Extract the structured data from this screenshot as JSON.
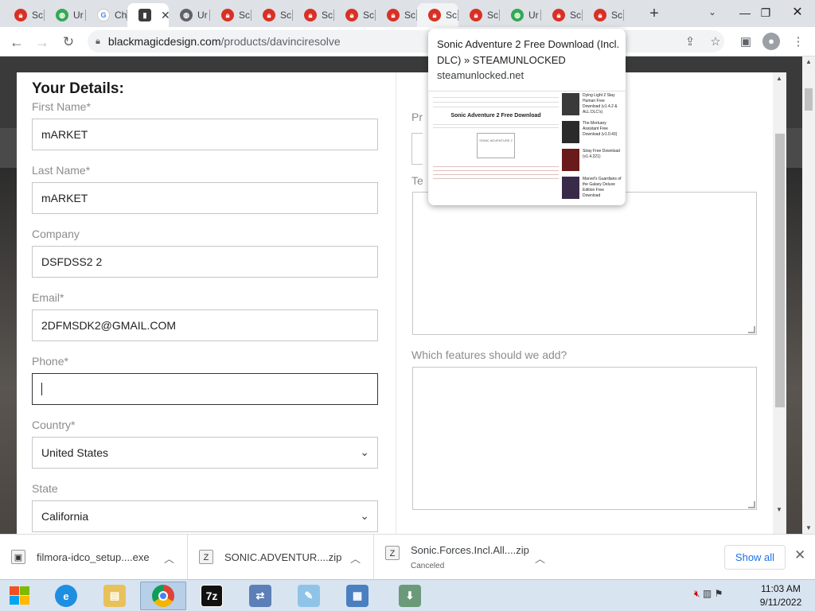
{
  "browser": {
    "tabs": [
      {
        "label": "Sc",
        "favicon": "red-lock-icon"
      },
      {
        "label": "Ur",
        "favicon": "green-globe-icon"
      },
      {
        "label": "Ch",
        "favicon": "google-icon"
      },
      {
        "label": "",
        "favicon": "dark-site-icon",
        "active": true
      },
      {
        "label": "Ur",
        "favicon": "globe-icon"
      },
      {
        "label": "Sc",
        "favicon": "red-lock-icon"
      },
      {
        "label": "Sc",
        "favicon": "red-lock-icon"
      },
      {
        "label": "Sc",
        "favicon": "red-lock-icon"
      },
      {
        "label": "Sc",
        "favicon": "red-lock-icon"
      },
      {
        "label": "Sc",
        "favicon": "red-lock-icon"
      },
      {
        "label": "Sc",
        "favicon": "red-lock-icon",
        "hovered": true
      },
      {
        "label": "Sc",
        "favicon": "red-lock-icon"
      },
      {
        "label": "Ur",
        "favicon": "green-globe-icon"
      },
      {
        "label": "Sc",
        "favicon": "red-lock-icon"
      },
      {
        "label": "Sc",
        "favicon": "red-lock-icon"
      }
    ],
    "url": {
      "host": "blackmagicdesign.com",
      "path": "/products/davinciresolve"
    },
    "hover_card": {
      "title": "Sonic Adventure 2 Free Download (Incl. DLC) » STEAMUNLOCKED",
      "domain": "steamunlocked.net",
      "thumb_heading": "Sonic Adventure 2 Free Download",
      "thumb_box": "SONIC ADVENTURE 2",
      "side_items": [
        "Dying Light 2 Stay Human Free Download (v1.4.2 & ALL DLC's)",
        "The Mortuary Assistant Free Download (v1.0.43)",
        "Stray Free Download (v1.4.221)",
        "Marvel's Guardians of the Galaxy Deluxe Edition Free Download"
      ]
    }
  },
  "form": {
    "heading": "Your Details:",
    "first_name": {
      "label": "First Name*",
      "value": "mARKET"
    },
    "last_name": {
      "label": "Last Name*",
      "value": "mARKET"
    },
    "company": {
      "label": "Company",
      "value": "DSFDSS2 2"
    },
    "email": {
      "label": "Email*",
      "value": "2DFMSDK2@GMAIL.COM"
    },
    "phone": {
      "label": "Phone*",
      "value": ""
    },
    "country": {
      "label": "Country*",
      "value": "United States"
    },
    "state": {
      "label": "State",
      "value": "California"
    },
    "right_label_1": "Pr",
    "right_label_2": "Te",
    "features": {
      "label": "Which features should we add?"
    }
  },
  "downloads": [
    {
      "name": "filmora-idco_setup....exe",
      "status": ""
    },
    {
      "name": "SONIC.ADVENTUR....zip",
      "status": ""
    },
    {
      "name": "Sonic.Forces.Incl.All....zip",
      "status": "Canceled"
    }
  ],
  "downloads_show_all": "Show all",
  "taskbar": {
    "clock_time": "11:03 AM",
    "clock_date": "9/11/2022",
    "apps": [
      "internet-explorer-icon",
      "file-explorer-icon",
      "chrome-icon",
      "7zip-icon",
      "network-app-icon",
      "notepad-icon",
      "control-panel-icon",
      "installer-icon"
    ]
  },
  "colors": {
    "accent": "#1a73e8",
    "tabstrip": "#dee1e6"
  }
}
